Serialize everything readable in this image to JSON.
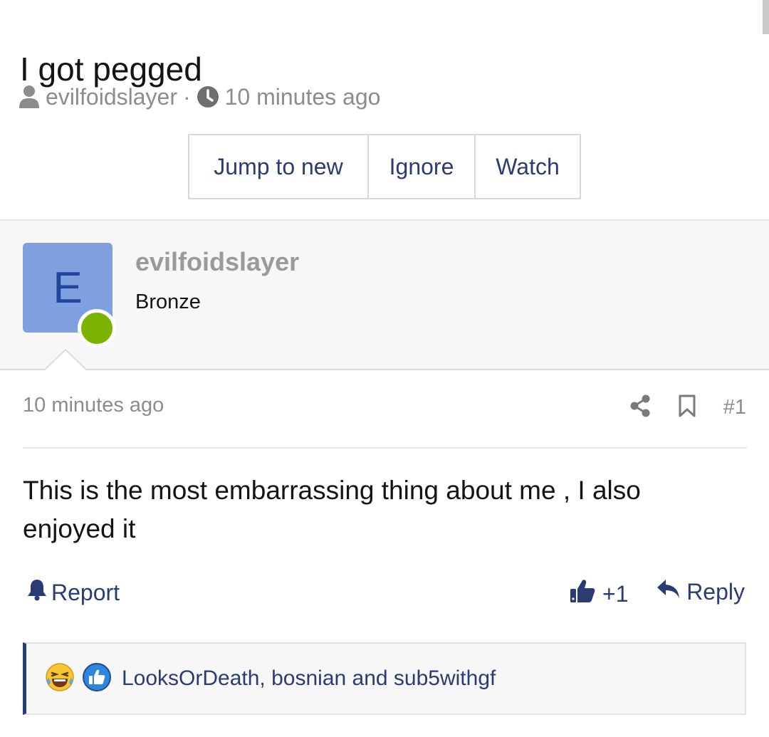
{
  "thread": {
    "title": "I got pegged",
    "author": "evilfoidslayer",
    "separator": "·",
    "time": "10 minutes ago"
  },
  "toolbar": {
    "jump_label": "Jump to new",
    "ignore_label": "Ignore",
    "watch_label": "Watch"
  },
  "post": {
    "avatar_letter": "E",
    "username": "evilfoidslayer",
    "user_title": "Bronze",
    "time": "10 minutes ago",
    "number": "#1",
    "body": "This is the most embarrassing thing about me , I also enjoyed it",
    "report_label": "Report",
    "reaction_count": "+1",
    "reply_label": "Reply",
    "reactions_by": "LooksOrDeath, bosnian and sub5withgf"
  },
  "colors": {
    "link": "#2a3c72",
    "avatar_bg": "#7f9fdf",
    "online": "#7ab300",
    "meta": "#8c8c8c"
  },
  "icons": [
    "user-icon",
    "clock-icon",
    "share-icon",
    "bookmark-icon",
    "bell-icon",
    "thumbs-up-icon",
    "reply-icon",
    "laugh-emoji-icon",
    "like-badge-icon"
  ]
}
